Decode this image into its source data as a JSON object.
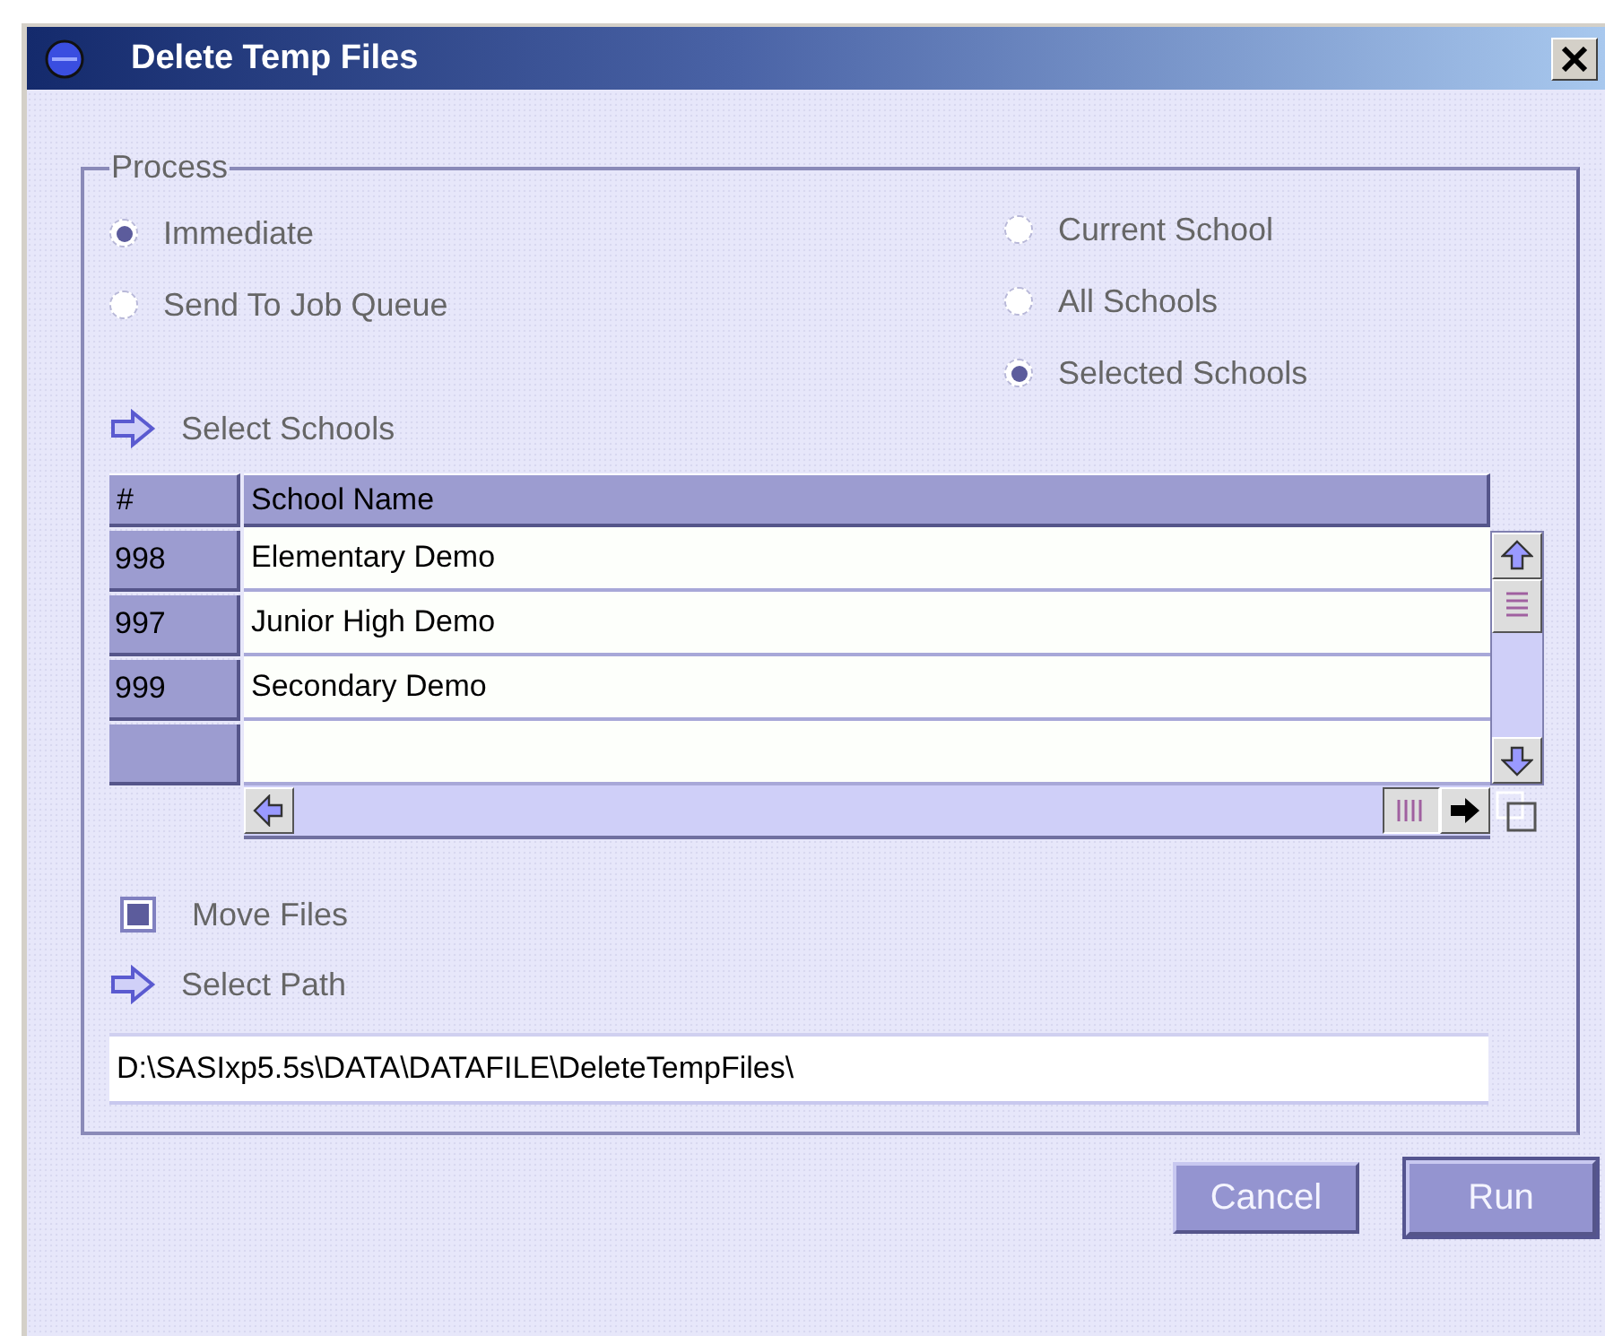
{
  "window": {
    "title": "Delete Temp Files"
  },
  "process": {
    "legend": "Process",
    "mode_options": [
      {
        "label": "Immediate",
        "selected": true
      },
      {
        "label": "Send To Job Queue",
        "selected": false
      }
    ],
    "scope_options": [
      {
        "label": "Current School",
        "selected": false
      },
      {
        "label": "All Schools",
        "selected": false
      },
      {
        "label": "Selected Schools",
        "selected": true
      }
    ],
    "select_schools_link": "Select Schools",
    "table": {
      "columns": [
        "#",
        "School Name"
      ],
      "rows": [
        {
          "number": "998",
          "name": "Elementary Demo"
        },
        {
          "number": "997",
          "name": "Junior High Demo"
        },
        {
          "number": "999",
          "name": "Secondary Demo"
        }
      ]
    },
    "move_files": {
      "label": "Move Files",
      "checked": true
    },
    "select_path_link": "Select Path",
    "path_field": {
      "value": "D:\\SASIxp5.5s\\DATA\\DATAFILE\\DeleteTempFiles\\"
    }
  },
  "buttons": [
    {
      "label": "Cancel",
      "default": false
    },
    {
      "label": "Run",
      "default": true
    }
  ]
}
